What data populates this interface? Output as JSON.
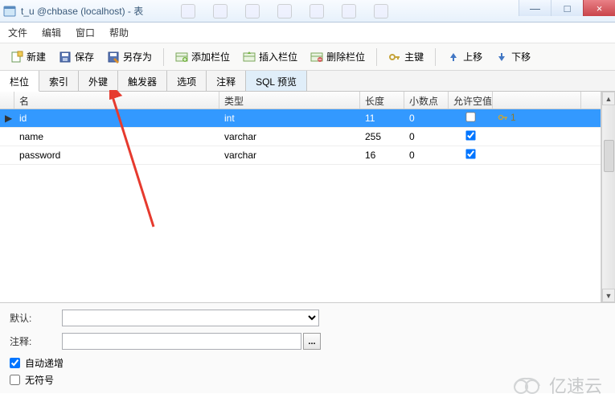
{
  "window": {
    "title": "t_u @chbase (localhost) - 表",
    "buttons": {
      "min": "—",
      "max": "□",
      "close": "×"
    }
  },
  "menu": {
    "file": "文件",
    "edit": "编辑",
    "window": "窗口",
    "help": "帮助"
  },
  "toolbar": {
    "new": "新建",
    "save": "保存",
    "saveas": "另存为",
    "add_field": "添加栏位",
    "insert_field": "插入栏位",
    "delete_field": "删除栏位",
    "primary_key": "主键",
    "move_up": "上移",
    "move_down": "下移"
  },
  "tabs": [
    {
      "key": "fields",
      "label": "栏位",
      "active": true
    },
    {
      "key": "indexes",
      "label": "索引"
    },
    {
      "key": "fk",
      "label": "外键"
    },
    {
      "key": "triggers",
      "label": "触发器"
    },
    {
      "key": "options",
      "label": "选项"
    },
    {
      "key": "comments",
      "label": "注释"
    },
    {
      "key": "sql",
      "label": "SQL 预览",
      "class": "sql"
    }
  ],
  "columns": {
    "name": "名",
    "type": "类型",
    "length": "长度",
    "decimals": "小数点",
    "allow_null": "允许空值 ("
  },
  "rows": [
    {
      "name": "id",
      "type": "int",
      "length": "11",
      "decimals": "0",
      "allow_null": false,
      "pk": "1",
      "selected": true
    },
    {
      "name": "name",
      "type": "varchar",
      "length": "255",
      "decimals": "0",
      "allow_null": true,
      "pk": ""
    },
    {
      "name": "password",
      "type": "varchar",
      "length": "16",
      "decimals": "0",
      "allow_null": true,
      "pk": ""
    }
  ],
  "bottom": {
    "default_label": "默认:",
    "comment_label": "注释:",
    "auto_increment_label": "自动递增",
    "unsigned_label": "无符号",
    "dots": "...",
    "auto_increment_checked": true,
    "unsigned_checked": false
  },
  "watermark": "亿速云"
}
